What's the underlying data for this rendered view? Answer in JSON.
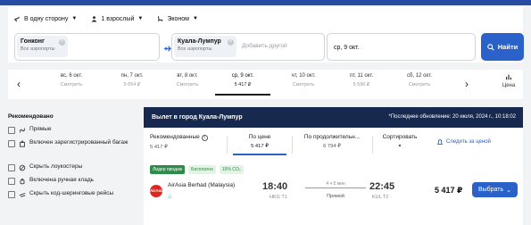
{
  "search": {
    "trip_type": "В одну сторону",
    "passengers": "1 взрослый",
    "cabin_class": "Эконом",
    "from": {
      "city": "Гонконг",
      "sub": "Все аэропорты"
    },
    "to": {
      "city": "Куала-Лумпур",
      "sub": "Все аэропорты"
    },
    "extra_placeholder": "Добавить другой",
    "date": "ср, 9 окт.",
    "find_label": "Найти"
  },
  "dates": [
    {
      "day": "вс, 6 окт.",
      "price": "Смотреть",
      "active": false
    },
    {
      "day": "пн, 7 окт.",
      "price": "5 654 ₽",
      "active": false
    },
    {
      "day": "вт, 8 окт.",
      "price": "Смотреть",
      "active": false
    },
    {
      "day": "ср, 9 окт.",
      "price": "5 417 ₽",
      "active": true
    },
    {
      "day": "чт, 10 окт.",
      "price": "Смотреть",
      "active": false
    },
    {
      "day": "пт, 11 окт.",
      "price": "5 596 ₽",
      "active": false
    },
    {
      "day": "сб, 12 окт.",
      "price": "Смотреть",
      "active": false
    }
  ],
  "price_chart_label": "Цена",
  "filters": {
    "title": "Рекомендовано",
    "items": [
      {
        "label": "Прямые",
        "icon": "route-icon"
      },
      {
        "label": "Включен зарегистрированный багаж",
        "icon": "suitcase-icon"
      },
      {
        "label": "Скрыть лоукостеры",
        "icon": "lowcost-icon"
      },
      {
        "label": "Включена ручная кладь",
        "icon": "cabin-bag-icon"
      },
      {
        "label": "Скрыть код-шеринговые рейсы",
        "icon": "codeshare-icon"
      }
    ]
  },
  "results": {
    "title": "Вылет в город Куала-Лумпур",
    "updated": "*Последнее обновление: 20 июля, 2024 г., 10:18:02",
    "sort": [
      {
        "label": "Рекомендованные",
        "value": "5 417 ₽",
        "selected": false
      },
      {
        "label": "По цене",
        "value": "5 417 ₽",
        "selected": true
      },
      {
        "label": "По продолжительн...",
        "value": "6 794 ₽",
        "selected": false
      },
      {
        "label": "Сортировать",
        "value": "",
        "selected": false
      }
    ],
    "subscribe_label": "Следить за ценой",
    "tags": [
      "Лидер продаж",
      "Бесплатно",
      "15% CO₂"
    ],
    "flight": {
      "airline": "AirAsia Berhad (Malaysia)",
      "logo_text": "AirAsia",
      "dep_time": "18:40",
      "dep_airport": "HKG T1",
      "duration": "4 ч 5 мин",
      "stops": "Прямой",
      "arr_time": "22:45",
      "arr_airport": "KUL T2",
      "price": "5 417 ₽",
      "choose_label": "Выбрать"
    }
  },
  "colors": {
    "accent": "#2a62c9",
    "header": "#17294f",
    "logo": "#e0261f"
  }
}
